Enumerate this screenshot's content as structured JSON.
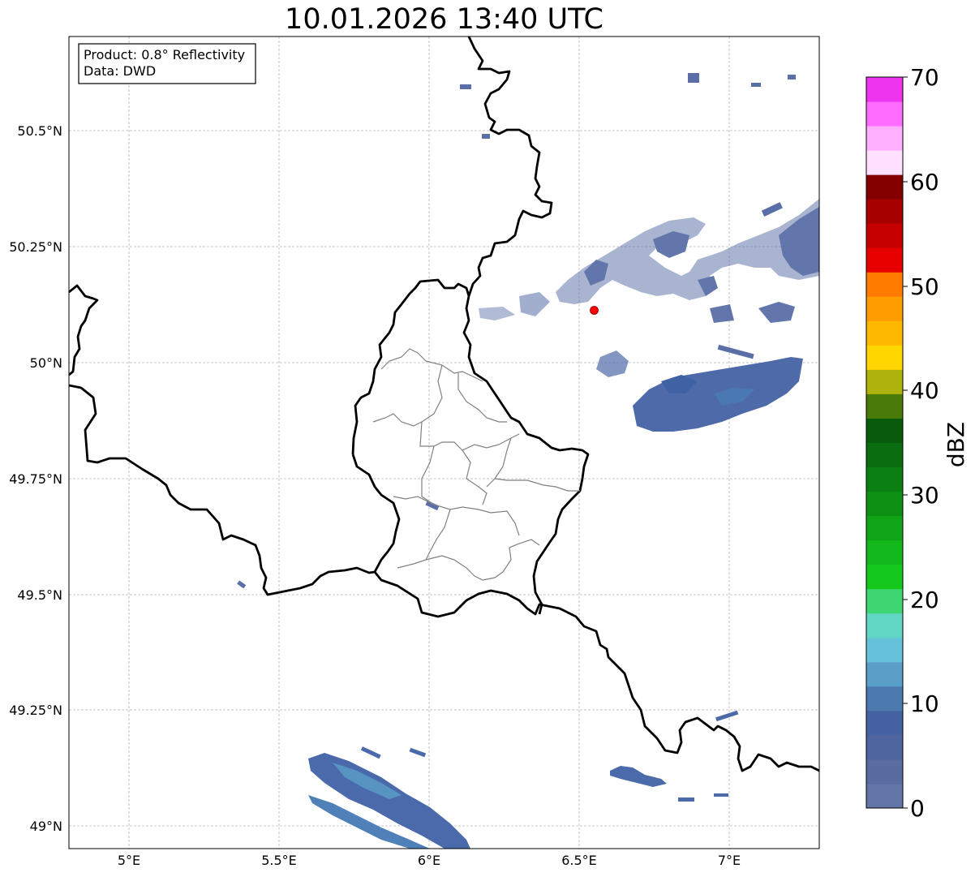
{
  "title": "10.01.2026 13:40 UTC",
  "info_box": {
    "product": "Product: 0.8° Reflectivity",
    "data": "Data: DWD"
  },
  "colorbar": {
    "label": "dBZ",
    "ticks": [
      "0",
      "10",
      "20",
      "30",
      "40",
      "50",
      "60",
      "70"
    ],
    "range": [
      0,
      70
    ],
    "step": 2.5,
    "colors": [
      "#6475a7",
      "#586ca2",
      "#4f659f",
      "#4562a2",
      "#4c7aaf",
      "#5a9fc8",
      "#66c2db",
      "#62d6c5",
      "#3ed672",
      "#14c81c",
      "#12b81c",
      "#10a519",
      "#0d9014",
      "#0b7f12",
      "#0a6d10",
      "#085b0b",
      "#4a7a0a",
      "#aeb20a",
      "#ffd600",
      "#ffba00",
      "#ff9c00",
      "#ff7c00",
      "#e60000",
      "#c60000",
      "#a60000",
      "#840000",
      "#ffe0ff",
      "#ffb0ff",
      "#ff6cff",
      "#ee34ee"
    ]
  },
  "axes": {
    "lon_ticks": [
      "5°E",
      "5.5°E",
      "6°E",
      "6.5°E",
      "7°E"
    ],
    "lat_ticks": [
      "50.5°N",
      "50.25°N",
      "50°N",
      "49.75°N",
      "49.5°N",
      "49.25°N",
      "49°N"
    ],
    "lon_range": [
      4.8,
      7.3
    ],
    "lat_range": [
      48.95,
      50.7
    ],
    "grid": true
  },
  "radar_site": {
    "lon": 6.55,
    "lat": 50.11,
    "color": "#ff0000"
  }
}
